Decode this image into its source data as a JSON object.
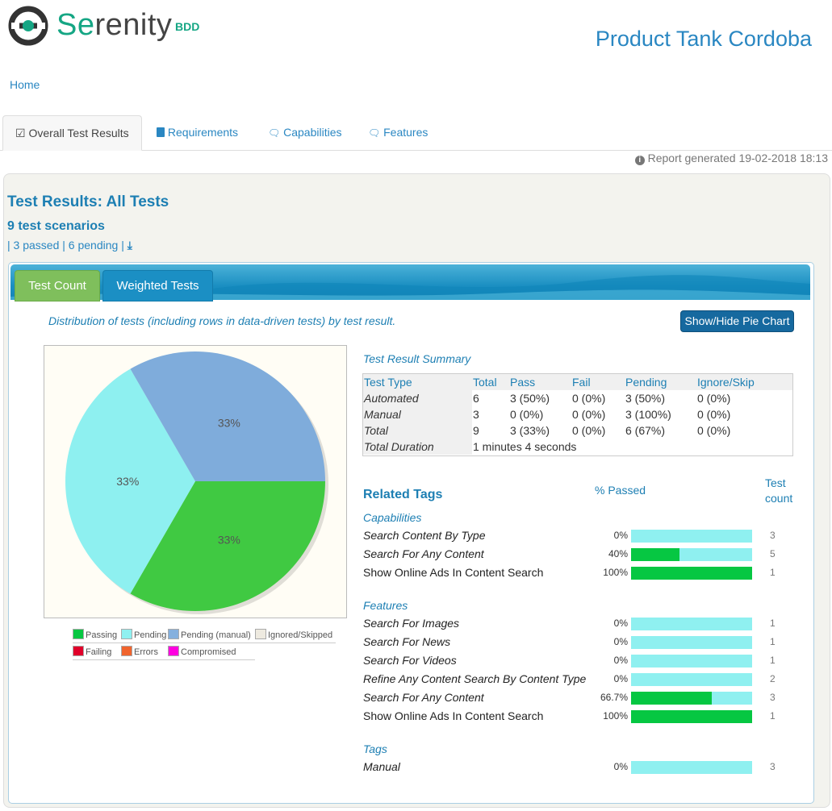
{
  "header": {
    "logo_text_se": "Se",
    "logo_text_rest": "renity",
    "logo_sub": "BDD",
    "project_title": "Product Tank Cordoba",
    "home_link": "Home"
  },
  "tabs": [
    {
      "label": "Overall Test Results",
      "icon": "check-square-icon"
    },
    {
      "label": "Requirements",
      "icon": "book-icon"
    },
    {
      "label": "Capabilities",
      "icon": "comments-icon"
    },
    {
      "label": "Features",
      "icon": "comments-icon"
    }
  ],
  "report_generated": "Report generated 19-02-2018 18:13",
  "results": {
    "title": "Test Results: All Tests",
    "scenarios": "9 test scenarios",
    "sep1": "|",
    "passed_link": "3 passed",
    "sep2": "|",
    "pending_link": "6 pending",
    "sep3": "|"
  },
  "chart_tabs": {
    "count": "Test Count",
    "weighted": "Weighted Tests"
  },
  "distribution_text": "Distribution of tests (including rows in data-driven tests) by test result.",
  "pie_button": "Show/Hide Pie Chart",
  "chart_data": {
    "type": "pie",
    "slices": [
      {
        "label": "Passing",
        "value": 3,
        "percent_label": "33%",
        "color": "#40c942"
      },
      {
        "label": "Pending",
        "value": 3,
        "percent_label": "33%",
        "color": "#8ef0f0"
      },
      {
        "label": "Pending (manual)",
        "value": 3,
        "percent_label": "33%",
        "color": "#7facdb"
      }
    ],
    "legend": [
      {
        "label": "Passing",
        "color": "#06c742"
      },
      {
        "label": "Pending",
        "color": "#8ff0f0"
      },
      {
        "label": "Pending (manual)",
        "color": "#84b0de"
      },
      {
        "label": "Ignored/Skipped",
        "color": "#eeeae0"
      },
      {
        "label": "Failing",
        "color": "#e0002a"
      },
      {
        "label": "Errors",
        "color": "#f0642d"
      },
      {
        "label": "Compromised",
        "color": "#ff00e0"
      }
    ]
  },
  "summary": {
    "title": "Test Result Summary",
    "headers": [
      "Test Type",
      "Total",
      "Pass",
      "Fail",
      "Pending",
      "Ignore/Skip"
    ],
    "rows": [
      [
        "Automated",
        "6",
        "3 (50%)",
        "0 (0%)",
        "3 (50%)",
        "0 (0%)"
      ],
      [
        "Manual",
        "3",
        "0 (0%)",
        "0 (0%)",
        "3 (100%)",
        "0 (0%)"
      ],
      [
        "Total",
        "9",
        "3 (33%)",
        "0 (0%)",
        "6 (67%)",
        "0 (0%)"
      ]
    ],
    "duration_label": "Total Duration",
    "duration_value": "1 minutes 4 seconds"
  },
  "related_tags": {
    "title": "Related Tags",
    "pct_header": "% Passed",
    "count_header_1": "Test",
    "count_header_2": "count",
    "groups": [
      {
        "name": "Capabilities",
        "items": [
          {
            "name": "Search Content By Type",
            "italic": true,
            "pct": "0%",
            "passed": 0,
            "count": "3"
          },
          {
            "name": "Search For Any Content",
            "italic": true,
            "pct": "40%",
            "passed": 40,
            "count": "5"
          },
          {
            "name": "Show Online Ads In Content Search",
            "italic": false,
            "pct": "100%",
            "passed": 100,
            "count": "1"
          }
        ]
      },
      {
        "name": "Features",
        "items": [
          {
            "name": "Search For Images",
            "italic": true,
            "pct": "0%",
            "passed": 0,
            "count": "1"
          },
          {
            "name": "Search For News",
            "italic": true,
            "pct": "0%",
            "passed": 0,
            "count": "1"
          },
          {
            "name": "Search For Videos",
            "italic": true,
            "pct": "0%",
            "passed": 0,
            "count": "1"
          },
          {
            "name": "Refine Any Content Search By Content Type",
            "italic": true,
            "pct": "0%",
            "passed": 0,
            "count": "2"
          },
          {
            "name": "Search For Any Content",
            "italic": true,
            "pct": "66.7%",
            "passed": 66.7,
            "count": "3"
          },
          {
            "name": "Show Online Ads In Content Search",
            "italic": false,
            "pct": "100%",
            "passed": 100,
            "count": "1"
          }
        ]
      },
      {
        "name": "Tags",
        "items": [
          {
            "name": "Manual",
            "italic": true,
            "pct": "0%",
            "passed": 0,
            "count": "3"
          }
        ]
      }
    ]
  }
}
